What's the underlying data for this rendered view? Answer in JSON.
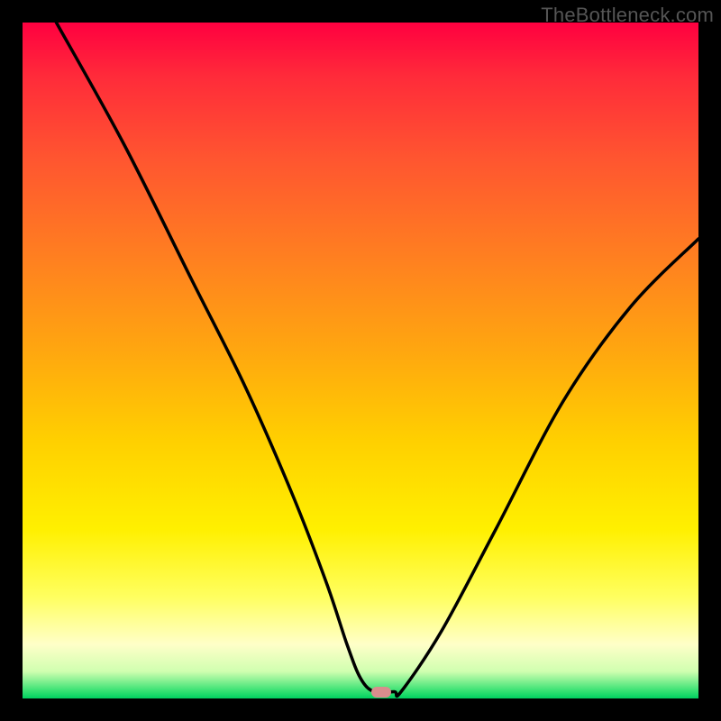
{
  "watermark": "TheBottleneck.com",
  "chart_data": {
    "type": "line",
    "title": "",
    "xlabel": "",
    "ylabel": "",
    "xlim": [
      0,
      100
    ],
    "ylim": [
      0,
      100
    ],
    "grid": false,
    "legend": "none",
    "background_gradient": {
      "top": "#ff0040",
      "middle": "#ffd000",
      "bottom": "#00d060"
    },
    "series": [
      {
        "name": "bottleneck-curve",
        "color": "#000000",
        "x": [
          5,
          15,
          25,
          33,
          40,
          45,
          48,
          50,
          52,
          55,
          56,
          62,
          70,
          80,
          90,
          100
        ],
        "values": [
          100,
          82,
          62,
          46,
          30,
          17,
          8,
          3,
          1,
          1,
          1,
          10,
          25,
          44,
          58,
          68
        ]
      }
    ],
    "annotations": [
      {
        "name": "optimal-marker",
        "x": 53,
        "y": 1,
        "shape": "pill",
        "color": "#d98d8d"
      }
    ]
  }
}
